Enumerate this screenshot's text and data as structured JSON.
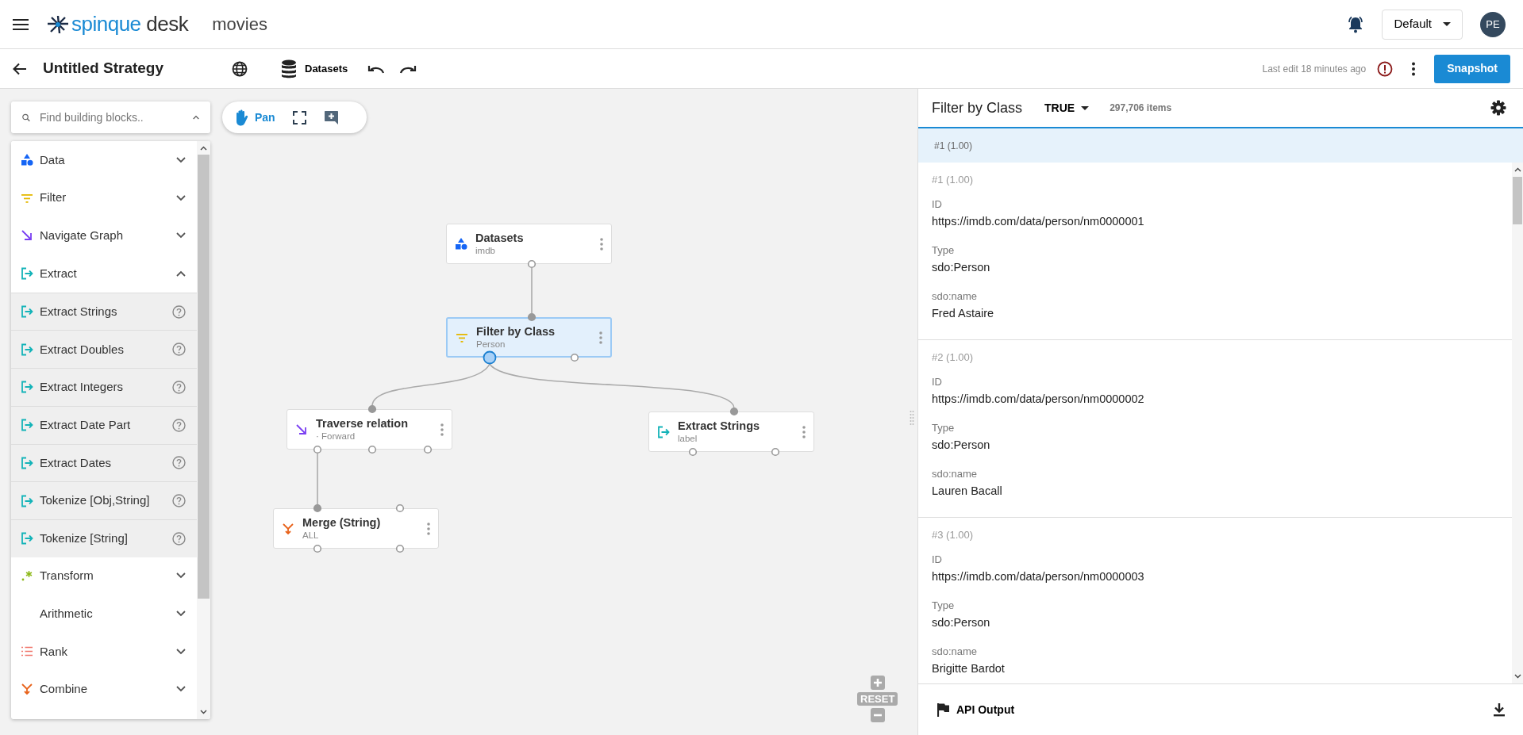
{
  "app": {
    "brand": "spinque",
    "product": "desk",
    "project": "movies"
  },
  "profile_menu": {
    "label": "Default"
  },
  "avatar": {
    "initials": "PE"
  },
  "strategy_bar": {
    "title": "Untitled Strategy",
    "datasets_label": "Datasets",
    "last_edit": "Last edit 18 minutes ago",
    "snapshot_button": "Snapshot"
  },
  "search": {
    "placeholder": "Find building blocks.."
  },
  "categories": [
    {
      "label": "Data",
      "kind": "data",
      "expanded": false
    },
    {
      "label": "Filter",
      "kind": "filter",
      "expanded": false
    },
    {
      "label": "Navigate Graph",
      "kind": "navigate",
      "expanded": false
    },
    {
      "label": "Extract",
      "kind": "extract",
      "expanded": true,
      "children": [
        {
          "label": "Extract Strings"
        },
        {
          "label": "Extract Doubles"
        },
        {
          "label": "Extract Integers"
        },
        {
          "label": "Extract Date Part"
        },
        {
          "label": "Extract Dates"
        },
        {
          "label": "Tokenize [Obj,String]"
        },
        {
          "label": "Tokenize [String]"
        }
      ]
    },
    {
      "label": "Transform",
      "kind": "transform",
      "expanded": false
    },
    {
      "label": "Arithmetic",
      "kind": "none",
      "expanded": false
    },
    {
      "label": "Rank",
      "kind": "rank",
      "expanded": false
    },
    {
      "label": "Combine",
      "kind": "combine",
      "expanded": false
    }
  ],
  "canvas_toolbar": {
    "pan_label": "Pan",
    "pan_selected": true
  },
  "nodes": [
    {
      "title": "Datasets",
      "subtitle": "imdb",
      "kind": "data",
      "selected": false
    },
    {
      "title": "Filter by Class",
      "subtitle": "Person",
      "kind": "filter",
      "selected": true
    },
    {
      "title": "Traverse relation",
      "subtitle": "· Forward",
      "kind": "navigate",
      "selected": false
    },
    {
      "title": "Extract Strings",
      "subtitle": "label",
      "kind": "extract",
      "selected": false
    },
    {
      "title": "Merge (String)",
      "subtitle": "ALL",
      "kind": "combine",
      "selected": false
    }
  ],
  "zoom_controls": {
    "reset_label": "RESET"
  },
  "results_panel": {
    "title": "Filter by Class",
    "filter_value": "TRUE",
    "count": "297,706 items",
    "selected_row": "#1 (1.00)",
    "records": [
      {
        "rank": "#1 (1.00)",
        "fields": [
          {
            "label": "ID",
            "value": "https://imdb.com/data/person/nm0000001"
          },
          {
            "label": "Type",
            "value": "sdo:Person"
          },
          {
            "label": "sdo:name",
            "value": "Fred Astaire"
          }
        ]
      },
      {
        "rank": "#2 (1.00)",
        "fields": [
          {
            "label": "ID",
            "value": "https://imdb.com/data/person/nm0000002"
          },
          {
            "label": "Type",
            "value": "sdo:Person"
          },
          {
            "label": "sdo:name",
            "value": "Lauren Bacall"
          }
        ]
      },
      {
        "rank": "#3 (1.00)",
        "fields": [
          {
            "label": "ID",
            "value": "https://imdb.com/data/person/nm0000003"
          },
          {
            "label": "Type",
            "value": "sdo:Person"
          },
          {
            "label": "sdo:name",
            "value": "Brigitte Bardot"
          }
        ]
      }
    ],
    "api_output": "API Output"
  }
}
